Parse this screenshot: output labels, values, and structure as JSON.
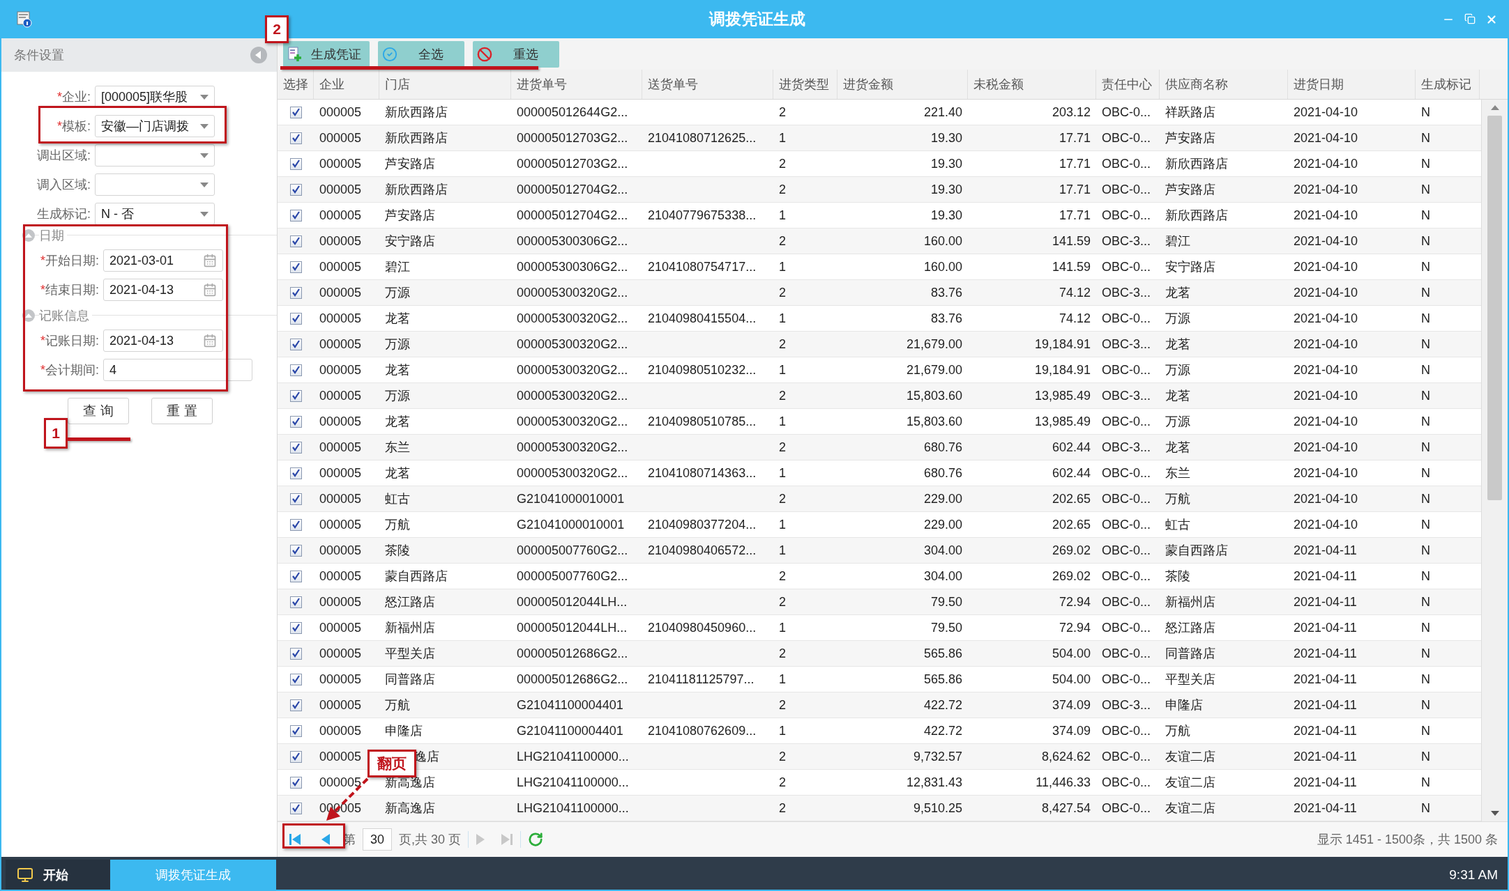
{
  "window": {
    "title": "调拨凭证生成"
  },
  "conditions": {
    "title": "条件设置",
    "fields": [
      {
        "kind": "select",
        "mark": "*",
        "label": "企业:",
        "value": "[000005]联华股"
      },
      {
        "kind": "select",
        "mark": "*",
        "label": "模板:",
        "value": "安徽—门店调拨"
      },
      {
        "kind": "select",
        "label": "调出区域:"
      },
      {
        "kind": "select",
        "label": "调入区域:"
      },
      {
        "kind": "select",
        "label": "生成标记:",
        "value": "N - 否"
      }
    ],
    "sections": [
      {
        "title": "日期",
        "fields": [
          {
            "kind": "date",
            "mark": "*",
            "label": "开始日期:",
            "value": "2021-03-01"
          },
          {
            "kind": "date",
            "mark": "*",
            "label": "结束日期:",
            "value": "2021-04-13"
          }
        ]
      },
      {
        "title": "记账信息",
        "fields": [
          {
            "kind": "date",
            "mark": "*",
            "label": "记账日期:",
            "value": "2021-04-13"
          },
          {
            "kind": "text",
            "mark": "*",
            "label": "会计期间:",
            "value": "4"
          }
        ]
      }
    ],
    "buttons": [
      "查 询",
      "重 置"
    ]
  },
  "toolbar": [
    {
      "kind": "generate",
      "label": "生成凭证"
    },
    {
      "kind": "select_all",
      "label": "全选"
    },
    {
      "kind": "reselect",
      "label": "重选"
    }
  ],
  "table": {
    "columns": [
      "选择",
      "企业",
      "门店",
      "进货单号",
      "送货单号",
      "进货类型",
      "进货金额",
      "未税金额",
      "责任中心",
      "供应商名称",
      "进货日期",
      "生成标记"
    ],
    "rows": [
      {
        "kind": "plain",
        "checked": true,
        "company": "000005",
        "store": "新欣西路店",
        "order_no": "000005012644G2...",
        "type": "2",
        "amount": "221.40",
        "net_amount": "203.12",
        "center": "OBC-0...",
        "supplier": "祥跃路店",
        "date": "2021-04-10",
        "flag": "N"
      },
      {
        "kind": "plain",
        "checked": true,
        "company": "000005",
        "store": "新欣西路店",
        "order_no": "000005012703G2...",
        "delivery_no": "21041080712625...",
        "type": "1",
        "amount": "19.30",
        "net_amount": "17.71",
        "center": "OBC-0...",
        "supplier": "芦安路店",
        "date": "2021-04-10",
        "flag": "N"
      },
      {
        "kind": "plain",
        "checked": true,
        "company": "000005",
        "store": "芦安路店",
        "order_no": "000005012703G2...",
        "type": "2",
        "amount": "19.30",
        "net_amount": "17.71",
        "center": "OBC-0...",
        "supplier": "新欣西路店",
        "date": "2021-04-10",
        "flag": "N"
      },
      {
        "kind": "plain",
        "checked": true,
        "company": "000005",
        "store": "新欣西路店",
        "order_no": "000005012704G2...",
        "type": "2",
        "amount": "19.30",
        "net_amount": "17.71",
        "center": "OBC-0...",
        "supplier": "芦安路店",
        "date": "2021-04-10",
        "flag": "N"
      },
      {
        "kind": "plain",
        "checked": true,
        "company": "000005",
        "store": "芦安路店",
        "order_no": "000005012704G2...",
        "delivery_no": "21040779675338...",
        "type": "1",
        "amount": "19.30",
        "net_amount": "17.71",
        "center": "OBC-0...",
        "supplier": "新欣西路店",
        "date": "2021-04-10",
        "flag": "N"
      },
      {
        "kind": "plain",
        "checked": true,
        "company": "000005",
        "store": "安宁路店",
        "order_no": "000005300306G2...",
        "type": "2",
        "amount": "160.00",
        "net_amount": "141.59",
        "center": "OBC-3...",
        "supplier": "碧江",
        "date": "2021-04-10",
        "flag": "N"
      },
      {
        "kind": "plain",
        "checked": true,
        "company": "000005",
        "store": "碧江",
        "order_no": "000005300306G2...",
        "delivery_no": "21041080754717...",
        "type": "1",
        "amount": "160.00",
        "net_amount": "141.59",
        "center": "OBC-0...",
        "supplier": "安宁路店",
        "date": "2021-04-10",
        "flag": "N"
      },
      {
        "kind": "plain",
        "checked": true,
        "company": "000005",
        "store": "万源",
        "order_no": "000005300320G2...",
        "type": "2",
        "amount": "83.76",
        "net_amount": "74.12",
        "center": "OBC-3...",
        "supplier": "龙茗",
        "date": "2021-04-10",
        "flag": "N"
      },
      {
        "kind": "plain",
        "checked": true,
        "company": "000005",
        "store": "龙茗",
        "order_no": "000005300320G2...",
        "delivery_no": "21040980415504...",
        "type": "1",
        "amount": "83.76",
        "net_amount": "74.12",
        "center": "OBC-0...",
        "supplier": "万源",
        "date": "2021-04-10",
        "flag": "N"
      },
      {
        "kind": "plain",
        "checked": true,
        "company": "000005",
        "store": "万源",
        "order_no": "000005300320G2...",
        "type": "2",
        "amount": "21,679.00",
        "net_amount": "19,184.91",
        "center": "OBC-3...",
        "supplier": "龙茗",
        "date": "2021-04-10",
        "flag": "N"
      },
      {
        "kind": "plain",
        "checked": true,
        "company": "000005",
        "store": "龙茗",
        "order_no": "000005300320G2...",
        "delivery_no": "21040980510232...",
        "type": "1",
        "amount": "21,679.00",
        "net_amount": "19,184.91",
        "center": "OBC-0...",
        "supplier": "万源",
        "date": "2021-04-10",
        "flag": "N"
      },
      {
        "kind": "plain",
        "checked": true,
        "company": "000005",
        "store": "万源",
        "order_no": "000005300320G2...",
        "type": "2",
        "amount": "15,803.60",
        "net_amount": "13,985.49",
        "center": "OBC-3...",
        "supplier": "龙茗",
        "date": "2021-04-10",
        "flag": "N"
      },
      {
        "kind": "plain",
        "checked": true,
        "company": "000005",
        "store": "龙茗",
        "order_no": "000005300320G2...",
        "delivery_no": "21040980510785...",
        "type": "1",
        "amount": "15,803.60",
        "net_amount": "13,985.49",
        "center": "OBC-0...",
        "supplier": "万源",
        "date": "2021-04-10",
        "flag": "N"
      },
      {
        "kind": "plain",
        "checked": true,
        "company": "000005",
        "store": "东兰",
        "order_no": "000005300320G2...",
        "type": "2",
        "amount": "680.76",
        "net_amount": "602.44",
        "center": "OBC-3...",
        "supplier": "龙茗",
        "date": "2021-04-10",
        "flag": "N"
      },
      {
        "kind": "plain",
        "checked": true,
        "company": "000005",
        "store": "龙茗",
        "order_no": "000005300320G2...",
        "delivery_no": "21041080714363...",
        "type": "1",
        "amount": "680.76",
        "net_amount": "602.44",
        "center": "OBC-0...",
        "supplier": "东兰",
        "date": "2021-04-10",
        "flag": "N"
      },
      {
        "kind": "plain",
        "checked": true,
        "company": "000005",
        "store": "虹古",
        "order_no": "G21041000010001",
        "type": "2",
        "amount": "229.00",
        "net_amount": "202.65",
        "center": "OBC-0...",
        "supplier": "万航",
        "date": "2021-04-10",
        "flag": "N"
      },
      {
        "kind": "plain",
        "checked": true,
        "company": "000005",
        "store": "万航",
        "order_no": "G21041000010001",
        "delivery_no": "21040980377204...",
        "type": "1",
        "amount": "229.00",
        "net_amount": "202.65",
        "center": "OBC-0...",
        "supplier": "虹古",
        "date": "2021-04-10",
        "flag": "N"
      },
      {
        "kind": "plain",
        "checked": true,
        "company": "000005",
        "store": "茶陵",
        "order_no": "000005007760G2...",
        "delivery_no": "21040980406572...",
        "type": "1",
        "amount": "304.00",
        "net_amount": "269.02",
        "center": "OBC-0...",
        "supplier": "蒙自西路店",
        "date": "2021-04-11",
        "flag": "N"
      },
      {
        "kind": "plain",
        "checked": true,
        "company": "000005",
        "store": "蒙自西路店",
        "order_no": "000005007760G2...",
        "type": "2",
        "amount": "304.00",
        "net_amount": "269.02",
        "center": "OBC-0...",
        "supplier": "茶陵",
        "date": "2021-04-11",
        "flag": "N"
      },
      {
        "kind": "plain",
        "checked": true,
        "company": "000005",
        "store": "怒江路店",
        "order_no": "000005012044LH...",
        "type": "2",
        "amount": "79.50",
        "net_amount": "72.94",
        "center": "OBC-0...",
        "supplier": "新福州店",
        "date": "2021-04-11",
        "flag": "N"
      },
      {
        "kind": "plain",
        "checked": true,
        "company": "000005",
        "store": "新福州店",
        "order_no": "000005012044LH...",
        "delivery_no": "21040980450960...",
        "type": "1",
        "amount": "79.50",
        "net_amount": "72.94",
        "center": "OBC-0...",
        "supplier": "怒江路店",
        "date": "2021-04-11",
        "flag": "N"
      },
      {
        "kind": "plain",
        "checked": true,
        "company": "000005",
        "store": "平型关店",
        "order_no": "000005012686G2...",
        "type": "2",
        "amount": "565.86",
        "net_amount": "504.00",
        "center": "OBC-0...",
        "supplier": "同普路店",
        "date": "2021-04-11",
        "flag": "N"
      },
      {
        "kind": "plain",
        "checked": true,
        "company": "000005",
        "store": "同普路店",
        "order_no": "000005012686G2...",
        "delivery_no": "21041181125797...",
        "type": "1",
        "amount": "565.86",
        "net_amount": "504.00",
        "center": "OBC-0...",
        "supplier": "平型关店",
        "date": "2021-04-11",
        "flag": "N"
      },
      {
        "kind": "plain",
        "checked": true,
        "company": "000005",
        "store": "万航",
        "order_no": "G21041100004401",
        "type": "2",
        "amount": "422.72",
        "net_amount": "374.09",
        "center": "OBC-3...",
        "supplier": "申隆店",
        "date": "2021-04-11",
        "flag": "N"
      },
      {
        "kind": "plain",
        "checked": true,
        "company": "000005",
        "store": "申隆店",
        "order_no": "G21041100004401",
        "delivery_no": "21041080762609...",
        "type": "1",
        "amount": "422.72",
        "net_amount": "374.09",
        "center": "OBC-0...",
        "supplier": "万航",
        "date": "2021-04-11",
        "flag": "N"
      },
      {
        "kind": "covered",
        "checked": true,
        "company": "000005",
        "store": "逸店",
        "order_no": "LHG21041100000...",
        "type": "2",
        "amount": "9,732.57",
        "net_amount": "8,624.62",
        "center": "OBC-0...",
        "supplier": "友谊二店",
        "date": "2021-04-11",
        "flag": "N"
      },
      {
        "kind": "plain",
        "checked": true,
        "company": "000005",
        "store": "新高逸店",
        "order_no": "LHG21041100000...",
        "type": "2",
        "amount": "12,831.43",
        "net_amount": "11,446.33",
        "center": "OBC-0...",
        "supplier": "友谊二店",
        "date": "2021-04-11",
        "flag": "N"
      },
      {
        "kind": "plain",
        "checked": true,
        "company": "000005",
        "store": "新高逸店",
        "order_no": "LHG21041100000...",
        "type": "2",
        "amount": "9,510.25",
        "net_amount": "8,427.54",
        "center": "OBC-0...",
        "supplier": "友谊二店",
        "date": "2021-04-11",
        "flag": "N"
      }
    ]
  },
  "pager": {
    "before": "第",
    "page": "30",
    "after": "页,共 30 页",
    "summary": "显示 1451 - 1500条，共 1500 条"
  },
  "annotations": {
    "toolbar_number": "2",
    "form_number": "1",
    "pager_callout": "翻页"
  },
  "taskbar": {
    "start": "开始",
    "task": "调拨凭证生成",
    "clock": "9:31 AM"
  }
}
